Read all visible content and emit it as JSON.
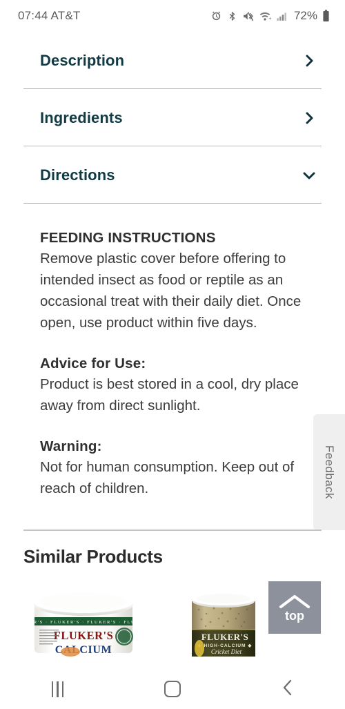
{
  "status_bar": {
    "time": "07:44",
    "carrier": "AT&T",
    "time_carrier": "07:44 AT&T",
    "battery_percent": "72%",
    "icons": [
      "alarm-icon",
      "bluetooth-icon",
      "mute-vibrate-icon",
      "wifi-icon",
      "cellular-signal-icon",
      "battery-icon"
    ]
  },
  "accordion": {
    "sections": [
      {
        "label": "Description",
        "state": "collapsed",
        "chevron": "chevron-right-icon"
      },
      {
        "label": "Ingredients",
        "state": "collapsed",
        "chevron": "chevron-right-icon"
      },
      {
        "label": "Directions",
        "state": "expanded",
        "chevron": "chevron-down-icon"
      }
    ],
    "accent_color": "#103b44"
  },
  "directions_panel": {
    "blocks": [
      {
        "heading": "FEEDING INSTRUCTIONS",
        "body": "Remove plastic cover before offering to intended insect as food or reptile as an occasional treat with their daily diet. Once open, use product within five days."
      },
      {
        "heading": "Advice for Use:",
        "body": "Product is best stored in a cool, dry place away from direct sunlight."
      },
      {
        "heading": "Warning:",
        "body": "Not for human consumption. Keep out of reach of children."
      }
    ]
  },
  "feedback_tab": {
    "label": "Feedback"
  },
  "similar_products": {
    "heading": "Similar Products",
    "items": [
      {
        "brand": "FLUKER'S",
        "name": "CALCIUM",
        "alt": "White jar of Fluker's Calcium reptile supplement"
      },
      {
        "brand": "FLUKER'S",
        "sub": "HIGH-CALCIUM",
        "name": "Cricket Diet",
        "alt": "Jar of Fluker's High-Calcium Cricket Diet"
      }
    ]
  },
  "back_to_top": {
    "label": "top",
    "icon": "chevron-up-icon",
    "color": "#8c919c"
  },
  "nav_bar": {
    "buttons": [
      {
        "name": "recents",
        "icon": "recents-icon"
      },
      {
        "name": "home",
        "icon": "home-square-icon"
      },
      {
        "name": "back",
        "icon": "chevron-left-icon"
      }
    ]
  }
}
